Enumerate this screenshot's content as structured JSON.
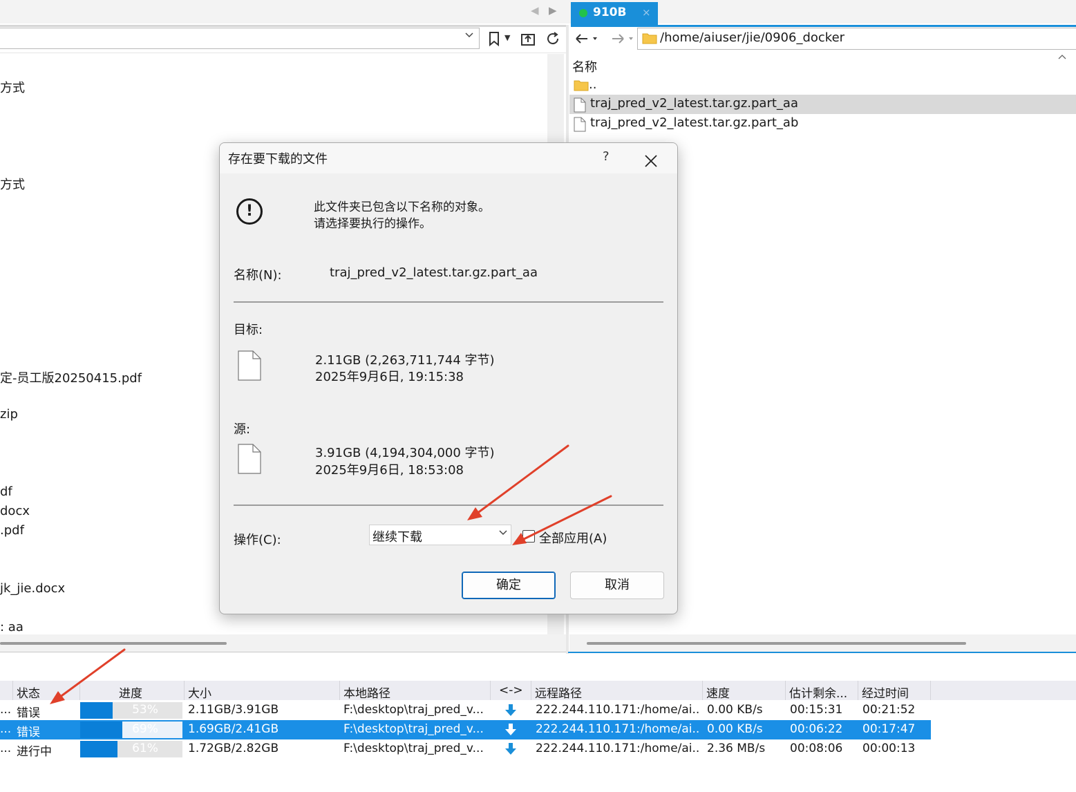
{
  "tabs": {
    "nav_prev": "◀",
    "nav_next": "▶",
    "active": {
      "label": "910B",
      "close": "×",
      "status_color": "#22c24a"
    }
  },
  "left_pane": {
    "path_value": "",
    "items": [
      "方式",
      "方式",
      "定-员工版20250415.pdf",
      "zip",
      "df",
      "docx",
      ".pdf",
      "jk_jie.docx",
      ": aa"
    ]
  },
  "right_pane": {
    "path_value": "/home/aiuser/jie/0906_docker",
    "column_name": "名称",
    "items": [
      {
        "name": "..",
        "type": "folder"
      },
      {
        "name": "traj_pred_v2_latest.tar.gz.part_aa",
        "type": "file",
        "selected": true
      },
      {
        "name": "traj_pred_v2_latest.tar.gz.part_ab",
        "type": "file"
      }
    ]
  },
  "dialog": {
    "title": "存在要下载的文件",
    "help": "?",
    "close": "✕",
    "message_line1": "此文件夹已包含以下名称的对象。",
    "message_line2": "请选择要执行的操作。",
    "name_label": "名称(N):",
    "name_value": "traj_pred_v2_latest.tar.gz.part_aa",
    "target_label": "目标:",
    "target_size": "2.11GB (2,263,711,744 字节)",
    "target_date": "2025年9月6日, 19:15:38",
    "source_label": "源:",
    "source_size": "3.91GB (4,194,304,000 字节)",
    "source_date": "2025年9月6日, 18:53:08",
    "operation_label": "操作(C):",
    "operation_value": "继续下载",
    "apply_all_label": "全部应用(A)",
    "apply_all_checked": false,
    "ok_label": "确定",
    "cancel_label": "取消"
  },
  "queue": {
    "columns": [
      "状态",
      "进度",
      "大小",
      "本地路径",
      "<->",
      "远程路径",
      "速度",
      "估计剩余...",
      "经过时间"
    ],
    "rows": [
      {
        "lead": "...",
        "status": "错误",
        "progress": 53,
        "progress_text": "53%",
        "size": "2.11GB/3.91GB",
        "local": "F:\\desktop\\traj_pred_v...",
        "remote": "222.244.110.171:/home/ai..",
        "speed": "0.00 KB/s",
        "remaining": "00:15:31",
        "elapsed": "00:21:52",
        "selected": false
      },
      {
        "lead": "...",
        "status": "错误",
        "progress": 69,
        "progress_text": "69%",
        "size": "1.69GB/2.41GB",
        "local": "F:\\desktop\\traj_pred_v...",
        "remote": "222.244.110.171:/home/ai..",
        "speed": "0.00 KB/s",
        "remaining": "00:06:22",
        "elapsed": "00:17:47",
        "selected": true
      },
      {
        "lead": "...",
        "status": "进行中",
        "progress": 61,
        "progress_text": "61%",
        "size": "1.72GB/2.82GB",
        "local": "F:\\desktop\\traj_pred_v...",
        "remote": "222.244.110.171:/home/ai..",
        "speed": "2.36 MB/s",
        "remaining": "00:08:06",
        "elapsed": "00:00:13",
        "selected": false
      }
    ]
  },
  "colors": {
    "accent": "#1a8fd9",
    "selection": "#1a8fe6",
    "progress_fill": "#0a7fd8",
    "annotation_arrow": "#e0402a"
  }
}
